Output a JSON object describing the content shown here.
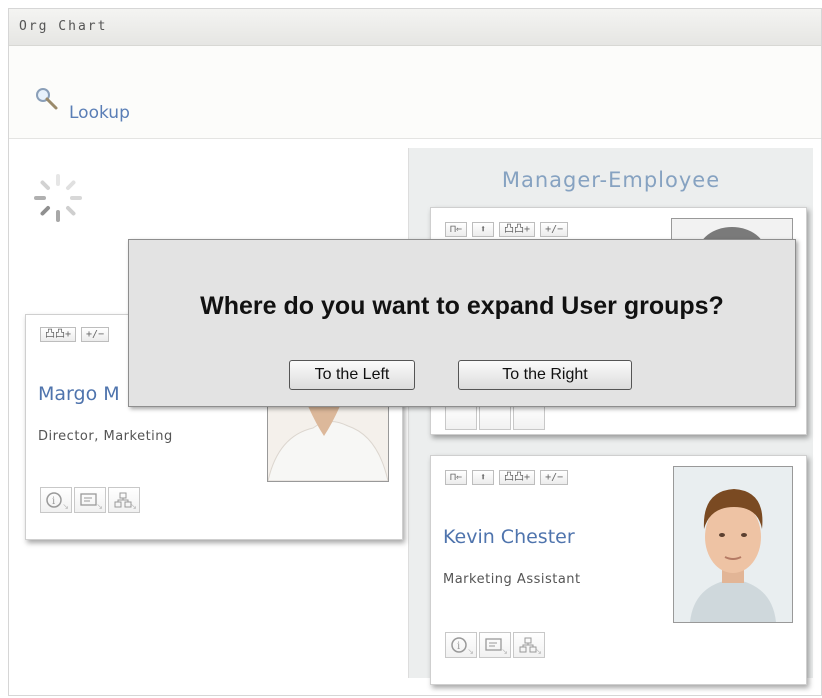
{
  "header": {
    "title": "Org Chart"
  },
  "lookup": {
    "label": "Lookup",
    "icon": "magnifier-icon"
  },
  "panel": {
    "title": "Manager-Employee"
  },
  "toolbar_labels": {
    "up_level": "⊓⇐",
    "up": "⬆",
    "expand_groups": "凸凸+",
    "toggle": "+/−"
  },
  "left_card": {
    "name": "Margo M",
    "title": "Director, Marketing"
  },
  "right_card_bottom": {
    "name": "Kevin Chester",
    "title": "Marketing Assistant"
  },
  "dialog": {
    "message": "Where do you want to expand User groups?",
    "left_button": "To the Left",
    "right_button": "To the Right"
  },
  "colors": {
    "link": "#5a7eb6",
    "panel_title": "#86a2c1",
    "dialog_bg": "#e3e3e3"
  }
}
